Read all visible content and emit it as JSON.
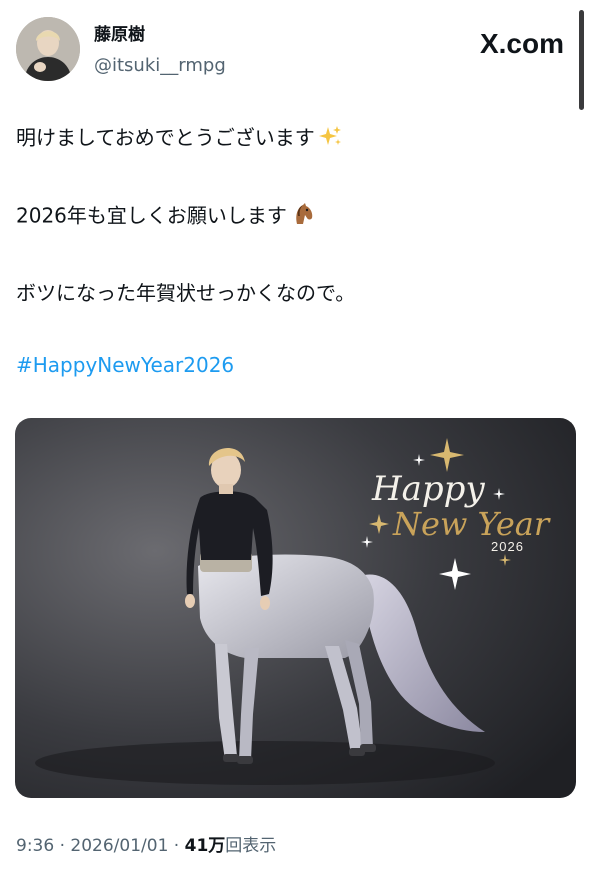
{
  "author": {
    "display_name": "藤原樹",
    "handle": "@itsuki__rmpg"
  },
  "brand": {
    "label": "X.com"
  },
  "tweet": {
    "line1": "明けましておめでとうございます",
    "line1_emoji": "sparkles-icon",
    "line2": "2026年も宜しくお願いします",
    "line2_emoji": "horse-face-icon",
    "line3": "ボツになった年賀状せっかくなので。",
    "hashtag": "#HappyNewYear2026"
  },
  "media": {
    "greeting_line1": "Happy",
    "greeting_line2": "New Year",
    "greeting_year": "2026"
  },
  "meta": {
    "time": "9:36",
    "sep1": " · ",
    "date": "2026/01/01",
    "sep2": " · ",
    "views_count": "41万",
    "views_label": "回表示"
  },
  "colors": {
    "hashtag": "#1d9bf0",
    "muted_text": "#536471",
    "gold": "#c9a35a"
  }
}
